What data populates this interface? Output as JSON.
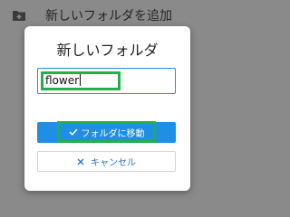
{
  "background": {
    "menu_item_label": "新しいフォルダを追加",
    "menu_icon": "folder-add-icon"
  },
  "dialog": {
    "title": "新しいフォルダ",
    "name_input_value": "flower",
    "move_button_label": "フォルダに移動",
    "move_button_icon": "check-icon",
    "cancel_button_label": "キャンセル",
    "cancel_button_icon": "close-icon"
  },
  "colors": {
    "accent": "#1f8fe6",
    "highlight": "#22b04b",
    "overlay": "#8a8a8a"
  }
}
